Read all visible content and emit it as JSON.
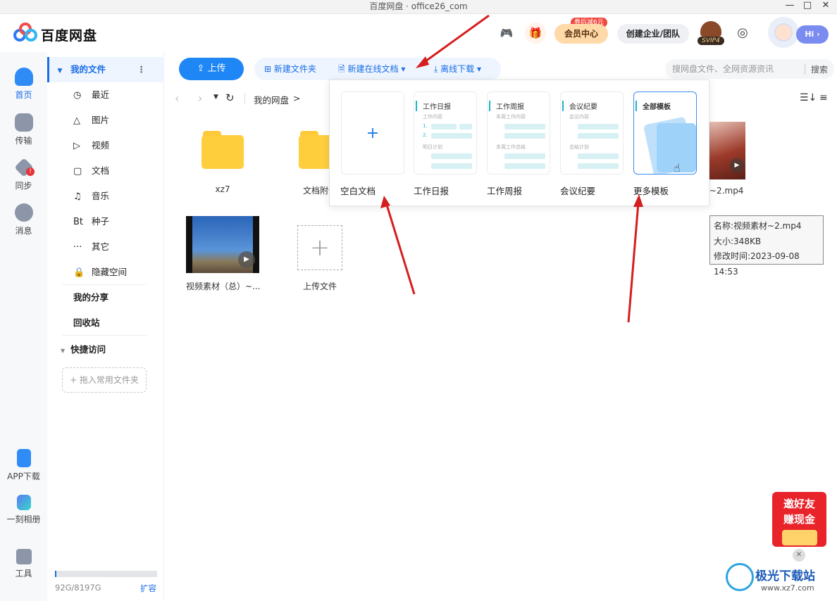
{
  "window": {
    "title": "百度网盘 · office26_com",
    "min": "—",
    "max": "□",
    "close": "✕"
  },
  "header": {
    "app_name": "百度网盘",
    "coupon": "券后减6元",
    "vip_center": "会员中心",
    "create_team": "创建企业/团队",
    "svip": "SVIP4",
    "hi": "Hi ›"
  },
  "rail": {
    "home": "首页",
    "transfer": "传输",
    "sync": "同步",
    "message": "消息",
    "app_download": "APP下载",
    "moments": "一刻相册",
    "tools": "工具"
  },
  "sidebar": {
    "my_files": "我的文件",
    "items": [
      "最近",
      "图片",
      "视频",
      "文档",
      "音乐",
      "种子",
      "其它",
      "隐藏空间"
    ],
    "icons": [
      "◷",
      "△",
      "▷",
      "▢",
      "♫",
      "Bt",
      "···",
      "🔒"
    ],
    "my_share": "我的分享",
    "recycle": "回收站",
    "quick_access": "快捷访问",
    "drag_hint": "+ 拖入常用文件夹",
    "storage": "92G/8197G",
    "expand": "扩容"
  },
  "toolbar": {
    "upload": "上传",
    "new_folder": "新建文件夹",
    "new_online_doc": "新建在线文档",
    "offline_download": "离线下载",
    "search_placeholder": "搜网盘文件、全网资源资讯",
    "search_btn": "搜索"
  },
  "breadcrumb": {
    "root": "我的网盘",
    "sep": ">"
  },
  "files": [
    {
      "name": "xz7"
    },
    {
      "name": "文档附件"
    },
    {
      "name": "~2.mp4"
    },
    {
      "name": "视频素材（总）~..."
    },
    {
      "name": "上传文件"
    }
  ],
  "popup": {
    "items": [
      {
        "label": "空白文档",
        "head": "",
        "lines": []
      },
      {
        "label": "工作日报",
        "head": "工作日报",
        "lines": [
          "工作内容",
          "1.",
          "2.",
          "明日计划"
        ]
      },
      {
        "label": "工作周报",
        "head": "工作周报",
        "lines": [
          "本周工作内容",
          "本周工作总结"
        ]
      },
      {
        "label": "会议纪要",
        "head": "会议纪要",
        "lines": [
          "会议内容",
          "总结计划"
        ]
      },
      {
        "label": "更多模板",
        "head": "全部模板",
        "lines": []
      }
    ]
  },
  "tooltip": {
    "name": "名称:视频素材~2.mp4",
    "size": "大小:348KB",
    "mtime": "修改时间:2023-09-08 14:53"
  },
  "promo": {
    "line1": "邀好友",
    "line2": "赚现金"
  },
  "watermark": {
    "text": "极光下载站",
    "url": "www.xz7.com"
  }
}
